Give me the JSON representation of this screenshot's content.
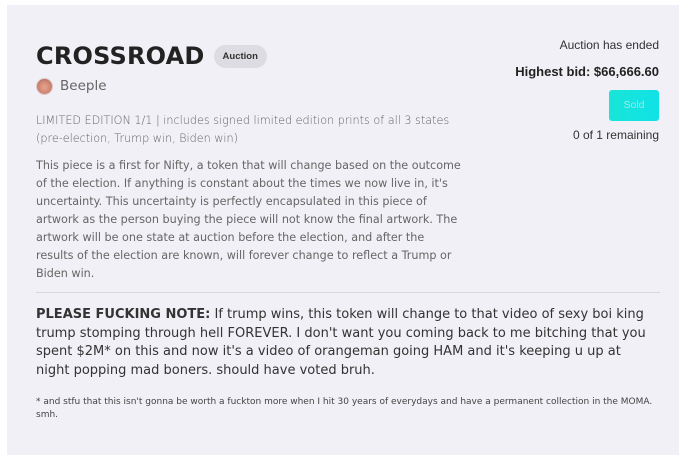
{
  "listing": {
    "title": "CROSSROAD",
    "badge": "Auction",
    "artist": "Beeple",
    "avatar_icon": "artist-avatar",
    "edition_text": "LIMITED EDITION 1/1 | includes signed limited edition prints of all 3 states (pre-election, Trump win, Biden win)",
    "description": "This piece is a first for Nifty, a token that will change based on the outcome of the election. If anything is constant about the times we now live in, it's uncertainty. This uncertainty is perfectly encapsulated in this piece of artwork as the person buying the piece will not know the final artwork. The artwork will be one state at auction before the election, and after the results of the election are known, will forever change to reflect a Trump or Biden win."
  },
  "auction": {
    "status": "Auction has ended",
    "highest_bid": "Highest bid: $66,666.60",
    "button_label": "Sold",
    "remaining": "0 of 1 remaining"
  },
  "note": {
    "label": "PLEASE FUCKING NOTE:",
    "text": " If trump wins, this token will change to that video of sexy boi king trump stomping through hell FOREVER. I don't want you coming back to me bitching that you spent $2M* on this and now it's a video of orangeman going HAM and it's keeping u up at night popping mad boners. should have voted bruh.",
    "footnote": "* and stfu that this isn't gonna be worth a fuckton more when I hit 30 years of everydays and have a permanent collection in the MOMA. smh."
  },
  "colors": {
    "card_background": "#f0f0f6",
    "button_gradient_start": "#19e5d8",
    "button_gradient_end": "#10e2e6"
  }
}
